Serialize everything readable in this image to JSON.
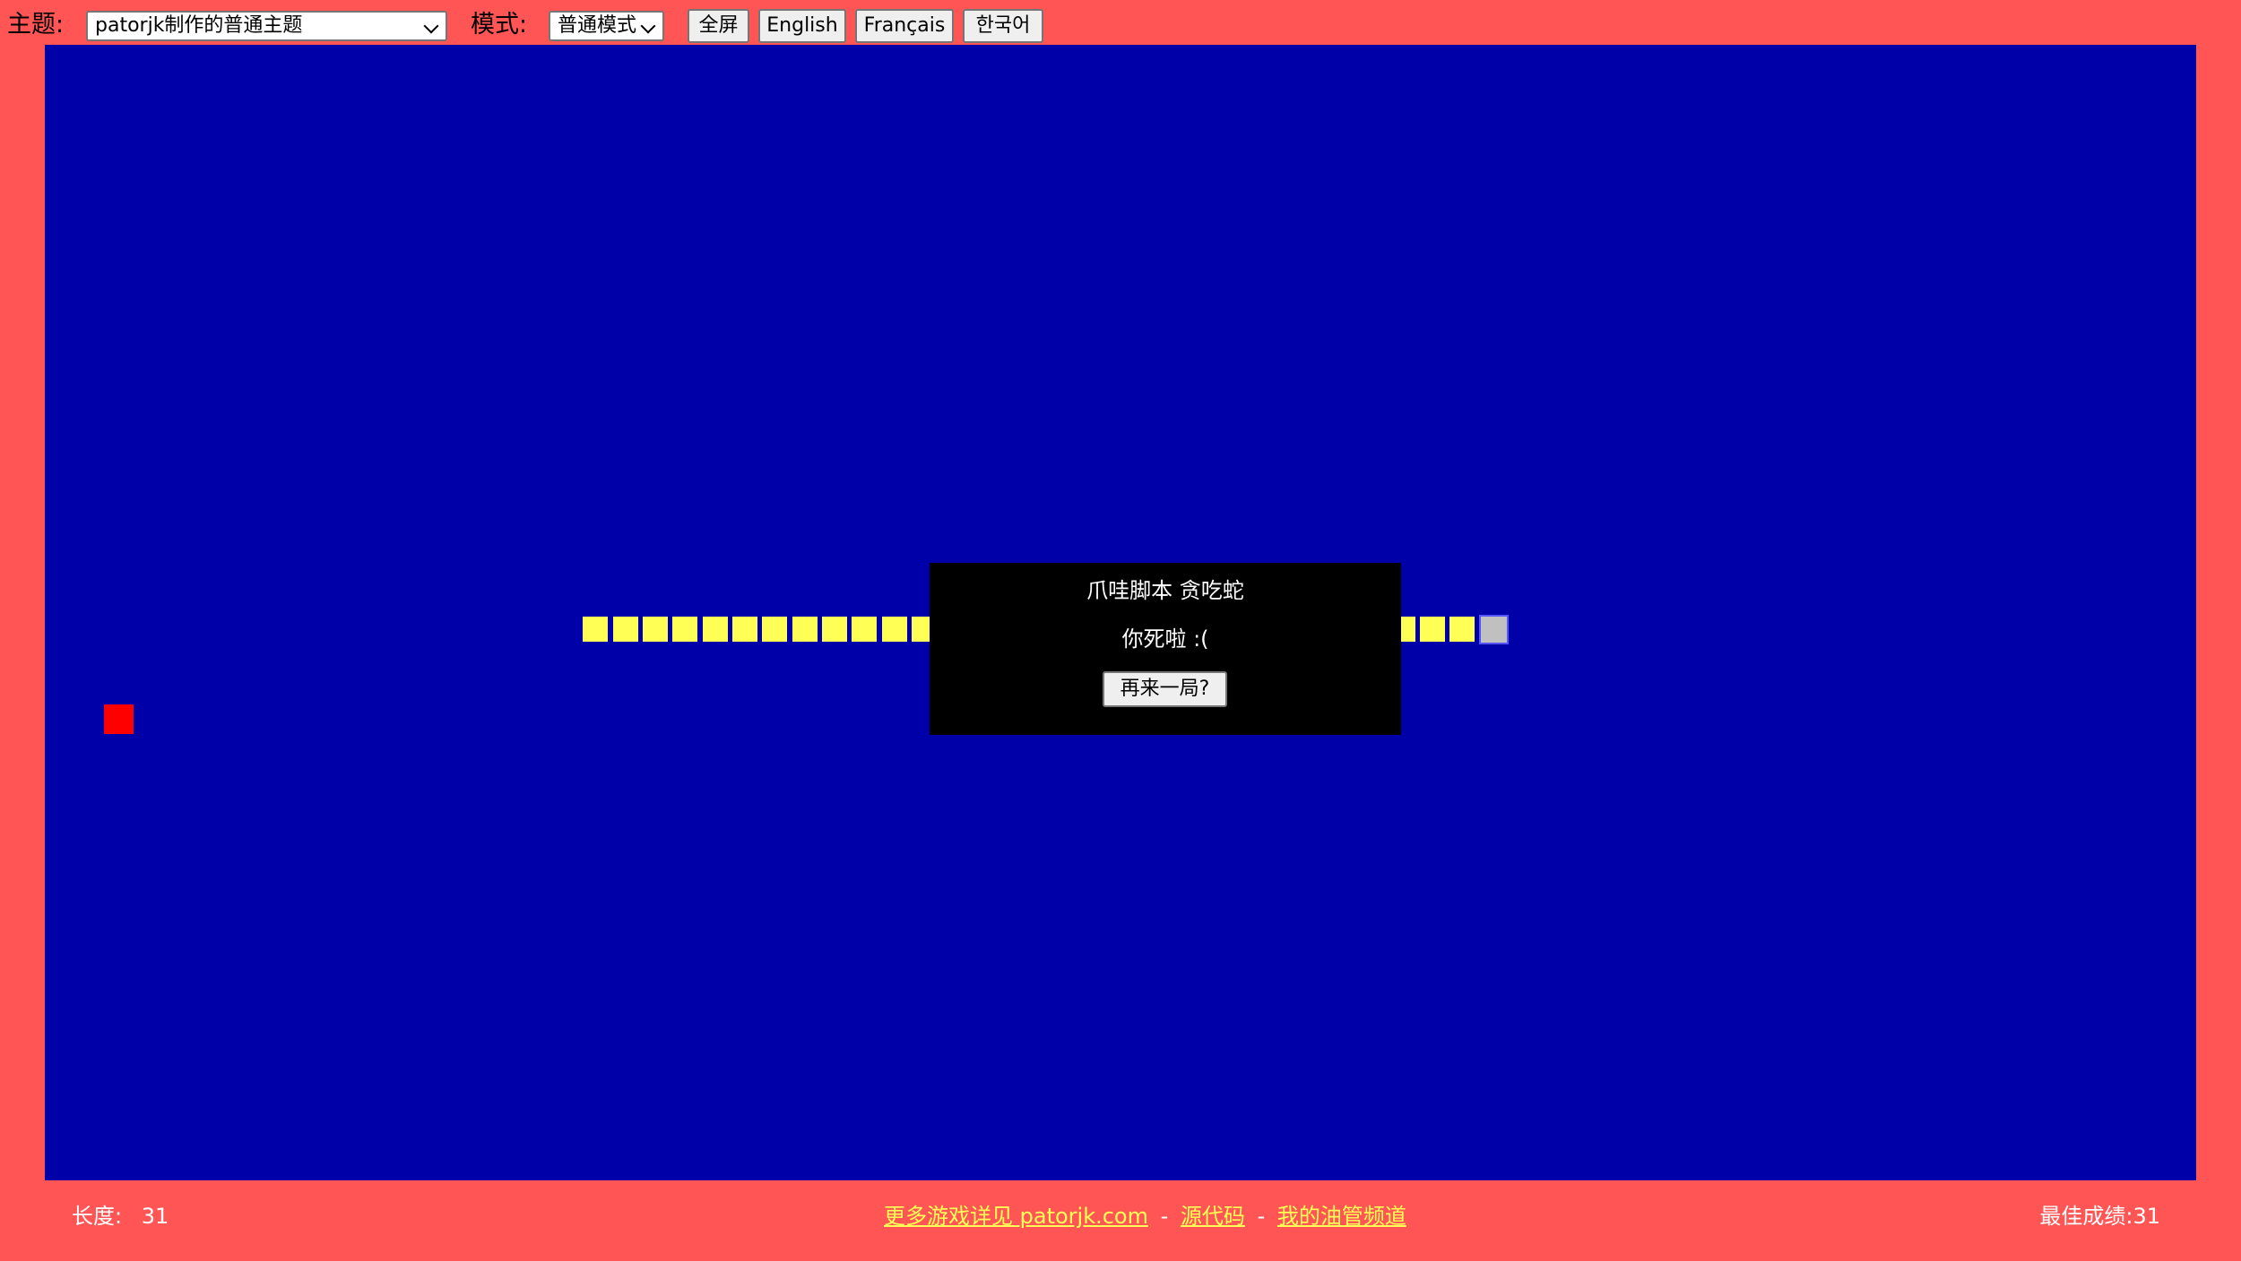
{
  "toolbar": {
    "theme_label": "主题:",
    "theme_value": "patorjk制作的普通主题",
    "mode_label": "模式:",
    "mode_value": "普通模式",
    "fullscreen_button": "全屏",
    "english_button": "English",
    "french_button": "Français",
    "korean_button": "한국어"
  },
  "game": {
    "snake_length": 31,
    "snake_head_cell": [
      48,
      19
    ],
    "snake_direction": "right",
    "food_cell": [
      1,
      22
    ],
    "colors": {
      "page_background": "#ff5555",
      "board": "#0000a8",
      "snake_body": "#ffff55",
      "snake_head": "#c0c0c0",
      "food": "#ff0000",
      "link": "#ffff55"
    }
  },
  "dialog": {
    "title": "爪哇脚本 贪吃蛇",
    "message": "你死啦 :(",
    "retry_button": "再来一局?"
  },
  "footer": {
    "length_label": "长度:",
    "length_value": "31",
    "more_games_link": "更多游戏详见 patorjk.com",
    "separator": "-",
    "source_link": "源代码",
    "youtube_link": "我的油管频道",
    "best_score_label": "最佳成绩:",
    "best_score_value": "31"
  }
}
